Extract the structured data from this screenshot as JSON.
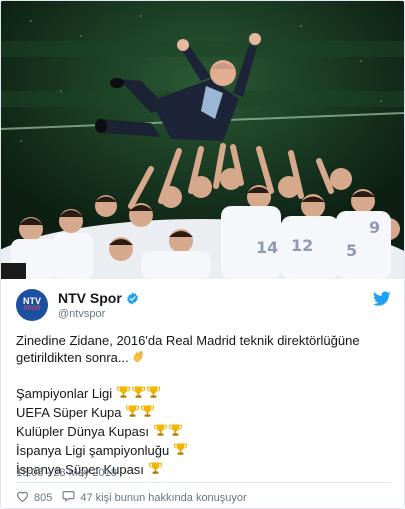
{
  "tweet": {
    "display_name": "NTV Spor",
    "handle": "@ntvspor",
    "avatar_line1": "NTV",
    "avatar_line2": "SPOR",
    "text_line1": "Zinedine Zidane, 2016'da Real Madrid teknik direktörlüğüne",
    "text_line2": "getirildikten sonra...",
    "titles": [
      {
        "name": "Şampiyonlar Ligi",
        "trophies": 3
      },
      {
        "name": "UEFA Süper Kupa",
        "trophies": 2
      },
      {
        "name": "Kulüpler Dünya Kupası",
        "trophies": 2
      },
      {
        "name": "İspanya Ligi şampiyonluğu",
        "trophies": 1
      },
      {
        "name": "İspanya Süper Kupası",
        "trophies": 1
      }
    ],
    "timestamp": "15:05 - 28 May 2018",
    "likes": "805",
    "replies_text": "47 kişi bunun hakkında konuşuyor"
  },
  "colors": {
    "verified": "#1da1f2",
    "twitter_blue": "#1da1f2",
    "trophy": "#f4b400",
    "muted": "#657786"
  },
  "icons": {
    "verified": "verified-badge-icon",
    "twitter": "twitter-bird-icon",
    "clap": "clapping-hands-icon",
    "trophy": "trophy-icon",
    "like": "heart-icon",
    "reply": "comment-icon"
  }
}
